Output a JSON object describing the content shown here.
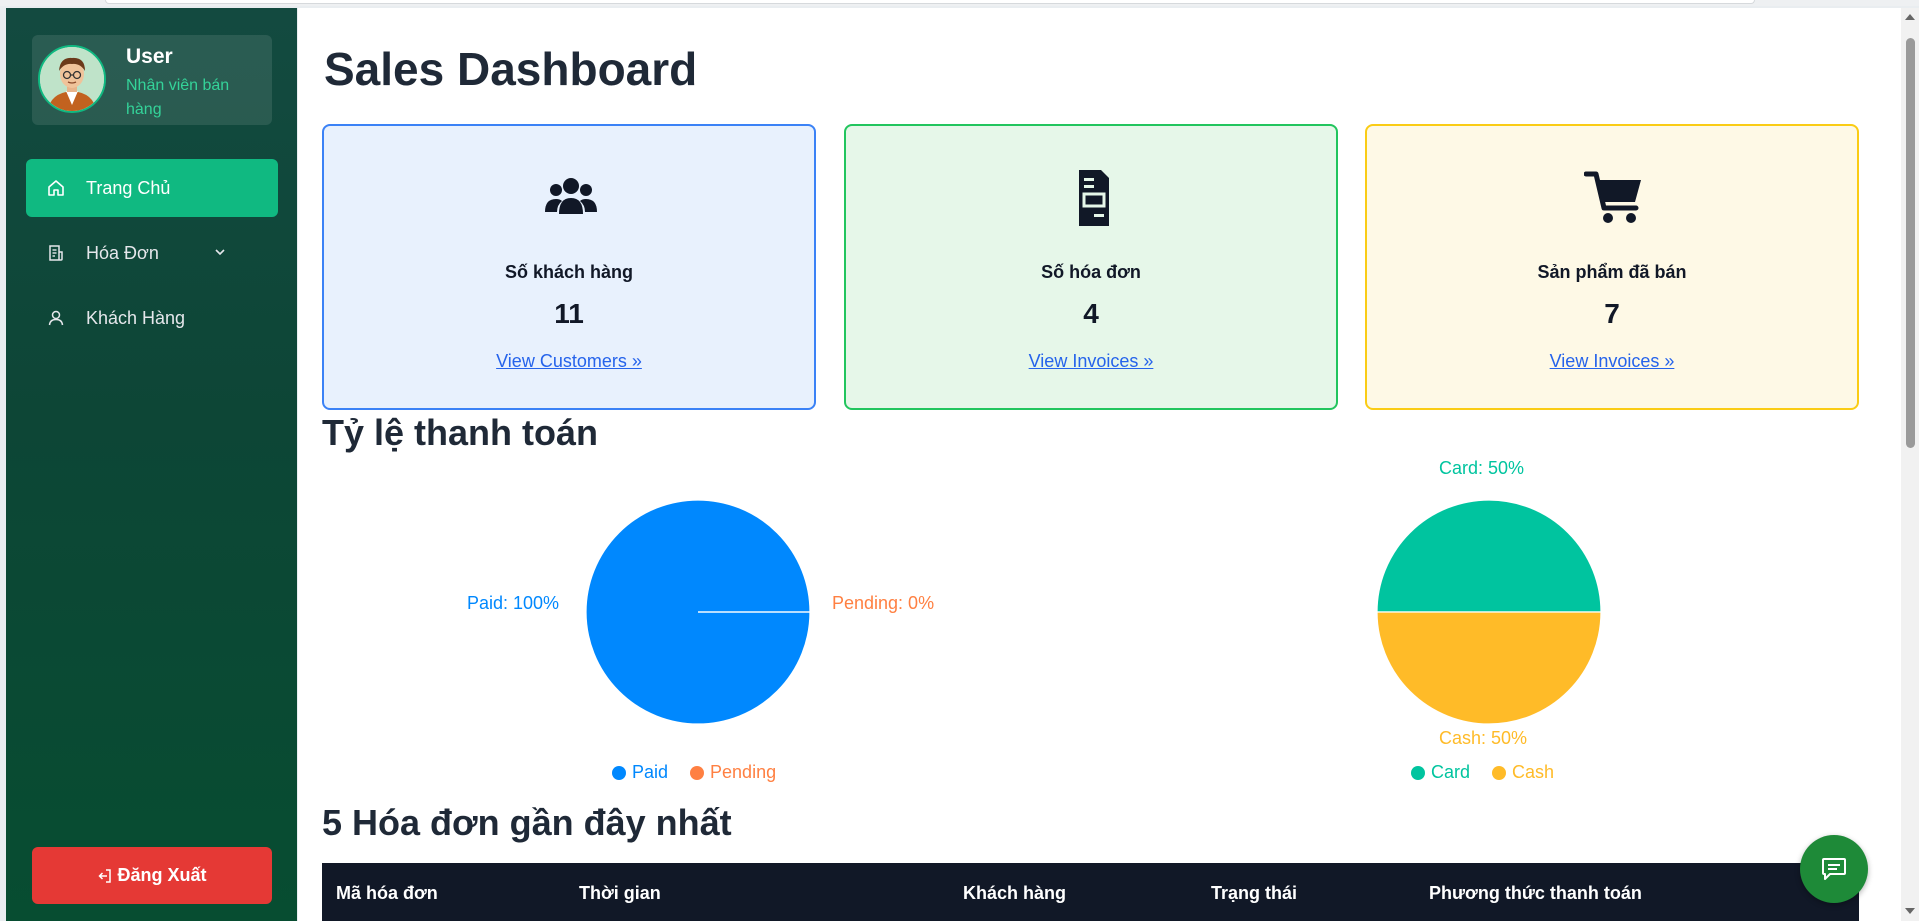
{
  "sidebar": {
    "user_name": "User",
    "user_role": "Nhân viên bán hàng",
    "nav": [
      {
        "label": "Trang Chủ",
        "icon": "home-icon",
        "active": true
      },
      {
        "label": "Hóa Đơn",
        "icon": "receipt-icon",
        "has_submenu": true
      },
      {
        "label": "Khách Hàng",
        "icon": "user-icon"
      }
    ],
    "logout_label": "Đăng Xuất"
  },
  "main": {
    "title": "Sales Dashboard",
    "cards": [
      {
        "title": "Số khách hàng",
        "value": "11",
        "link": "View Customers »",
        "icon": "users-icon",
        "color": "#3b82f6"
      },
      {
        "title": "Số hóa đơn",
        "value": "4",
        "link": "View Invoices »",
        "icon": "invoice-icon",
        "color": "#22c55e"
      },
      {
        "title": "Sản phẩm đã bán",
        "value": "7",
        "link": "View Invoices »",
        "icon": "cart-icon",
        "color": "#facc15"
      }
    ],
    "payment_section_title": "Tỷ lệ thanh toán",
    "recent_section_title": "5 Hóa đơn gần đây nhất",
    "table_headers": [
      "Mã hóa đơn",
      "Thời gian",
      "Khách hàng",
      "Trạng thái",
      "Phương thức thanh toán"
    ]
  },
  "chart_data": [
    {
      "type": "pie",
      "categories": [
        "Paid",
        "Pending"
      ],
      "values": [
        100,
        0
      ],
      "labels": [
        "Paid: 100%",
        "Pending: 0%"
      ],
      "colors": [
        "#0088fe",
        "#ff8042"
      ],
      "legend": "bottom"
    },
    {
      "type": "pie",
      "categories": [
        "Card",
        "Cash"
      ],
      "values": [
        50,
        50
      ],
      "labels": [
        "Card: 50%",
        "Cash: 50%"
      ],
      "colors": [
        "#00c49f",
        "#ffbb28"
      ],
      "legend": "bottom"
    }
  ]
}
